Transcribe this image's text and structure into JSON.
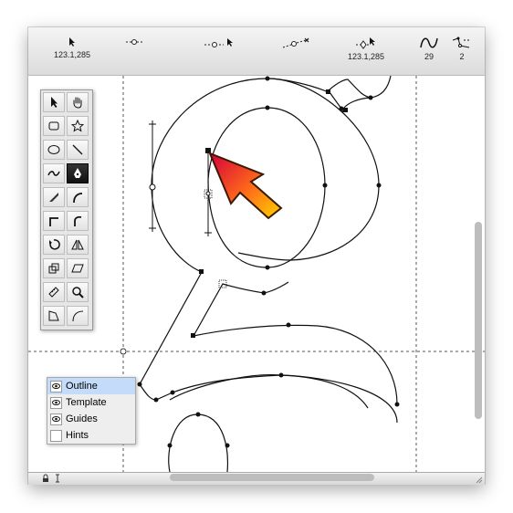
{
  "toolbar": {
    "items": [
      {
        "icon": "select-arrow-icon",
        "value": "123.1,285"
      },
      {
        "icon": "point-icon",
        "value": ""
      },
      {
        "icon": "point-drag-icon",
        "value": ""
      },
      {
        "icon": "bezier-handles-icon",
        "value": ""
      },
      {
        "icon": "move-point-icon",
        "value": "123.1,285"
      },
      {
        "icon": "curve-count-icon",
        "value": "29"
      },
      {
        "icon": "contour-count-icon",
        "value": "2"
      }
    ]
  },
  "tools": [
    {
      "name": "arrow-tool-icon"
    },
    {
      "name": "hand-tool-icon"
    },
    {
      "name": "rounded-rect-tool-icon"
    },
    {
      "name": "star-tool-icon"
    },
    {
      "name": "ellipse-tool-icon"
    },
    {
      "name": "line-tool-icon"
    },
    {
      "name": "freehand-tool-icon"
    },
    {
      "name": "pen-tool-icon",
      "active": true
    },
    {
      "name": "knife-tool-icon"
    },
    {
      "name": "curve-point-tool-icon"
    },
    {
      "name": "corner-point-tool-icon"
    },
    {
      "name": "tangent-point-tool-icon"
    },
    {
      "name": "rotate-tool-icon"
    },
    {
      "name": "flip-tool-icon"
    },
    {
      "name": "scale-tool-icon"
    },
    {
      "name": "skew-tool-icon"
    },
    {
      "name": "measure-tool-icon"
    },
    {
      "name": "zoom-tool-icon"
    },
    {
      "name": "perspective-tool-icon"
    },
    {
      "name": "arc-tool-icon"
    }
  ],
  "layers": [
    {
      "label": "Outline",
      "visible": true,
      "selected": true
    },
    {
      "label": "Template",
      "visible": true,
      "selected": false
    },
    {
      "label": "Guides",
      "visible": true,
      "selected": false
    },
    {
      "label": "Hints",
      "visible": false,
      "selected": false
    }
  ],
  "colors": {
    "selection": "#c4dcfa",
    "cursor_start": "#d4003a",
    "cursor_end": "#ffd400"
  }
}
